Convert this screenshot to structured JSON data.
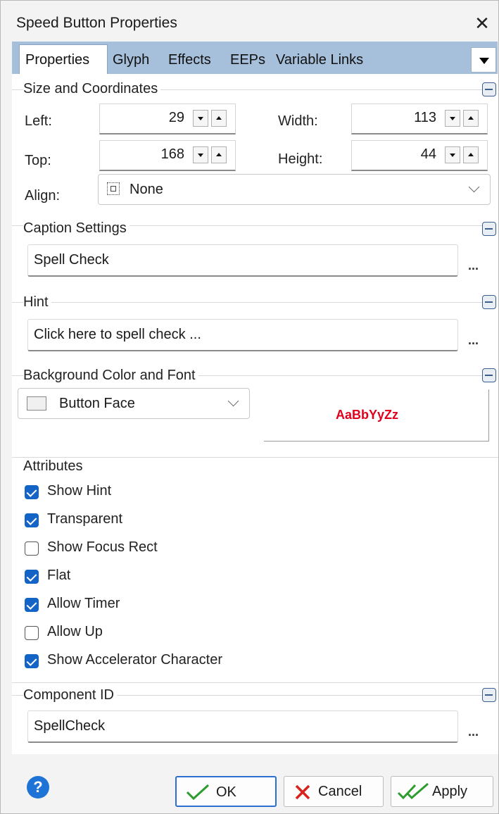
{
  "window": {
    "title": "Speed Button Properties",
    "close_symbol": "✕"
  },
  "tabs": [
    {
      "label": "Properties",
      "active": true
    },
    {
      "label": "Glyph"
    },
    {
      "label": "Effects"
    },
    {
      "label": "EEPs"
    },
    {
      "label": "Variable Links"
    }
  ],
  "size": {
    "title": "Size and Coordinates",
    "left_label": "Left:",
    "left_value": "29",
    "top_label": "Top:",
    "top_value": "168",
    "width_label": "Width:",
    "width_value": "113",
    "height_label": "Height:",
    "height_value": "44",
    "align_label": "Align:",
    "align_value": "None"
  },
  "caption": {
    "title": "Caption Settings",
    "value": "Spell Check",
    "ellipsis": "..."
  },
  "hint": {
    "title": "Hint",
    "value": "Click here to spell check ...",
    "ellipsis": "..."
  },
  "background": {
    "title": "Background Color and Font",
    "color_value": "Button Face",
    "font_sample": "AaBbYyZz",
    "font_sample_color": "#e0001b"
  },
  "attributes": {
    "title": "Attributes",
    "items": [
      {
        "label": "Show Hint",
        "checked": true
      },
      {
        "label": "Transparent",
        "checked": true
      },
      {
        "label": "Show Focus Rect",
        "checked": false
      },
      {
        "label": "Flat",
        "checked": true
      },
      {
        "label": "Allow Timer",
        "checked": true
      },
      {
        "label": "Allow Up",
        "checked": false
      },
      {
        "label": "Show Accelerator Character",
        "checked": true
      }
    ]
  },
  "component": {
    "title": "Component ID",
    "value": "SpellCheck",
    "ellipsis": "..."
  },
  "buttons": {
    "help": "?",
    "ok": "OK",
    "cancel": "Cancel",
    "apply": "Apply"
  },
  "colors": {
    "accent": "#1464c8",
    "tab_bar": "#a6bfda",
    "check_mark_green": "#2e9b2e",
    "cancel_x_red": "#d8221b"
  },
  "icons": [
    "close-icon",
    "tab-overflow-icon",
    "collapse-icon",
    "align-none-icon",
    "chevron-down-icon",
    "color-swatch-icon",
    "help-icon",
    "ok-check-icon",
    "cancel-x-icon",
    "apply-double-check-icon"
  ]
}
